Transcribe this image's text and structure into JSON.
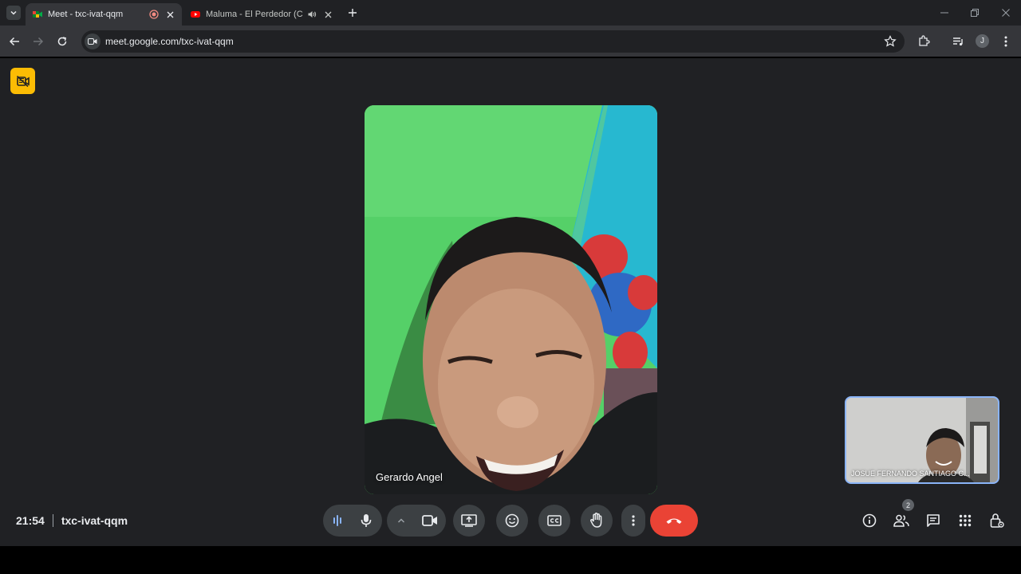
{
  "browser": {
    "tabs": [
      {
        "title": "Meet - txc-ivat-qqm",
        "active": true,
        "favicon": "google-meet-icon",
        "indicator": "recording-icon"
      },
      {
        "title": "Maluma - El Perdedor (Cover",
        "active": false,
        "favicon": "youtube-icon",
        "indicator": "audio-playing-icon"
      }
    ],
    "url": "meet.google.com/txc-ivat-qqm",
    "profile_initial": "J"
  },
  "meet": {
    "main_participant": "Gerardo Angel",
    "self_participant": "JOSUE FERNANDO SANTIAGO C...",
    "time": "21:54",
    "meeting_code": "txc-ivat-qqm",
    "participant_count": "2",
    "controls": [
      "audio-levels-icon",
      "microphone-icon",
      "chevron-up-icon",
      "camera-icon",
      "present-screen-icon",
      "emoji-icon",
      "captions-icon",
      "raise-hand-icon",
      "more-options-icon",
      "end-call-icon"
    ],
    "right_controls": [
      "info-icon",
      "people-icon",
      "chat-icon",
      "activities-icon",
      "host-controls-icon"
    ]
  },
  "colors": {
    "background": "#202124",
    "end_call": "#ea4335",
    "control": "#3c4043",
    "recording_badge": "#fbbc04",
    "self_tile_border": "#8ab4f8"
  }
}
